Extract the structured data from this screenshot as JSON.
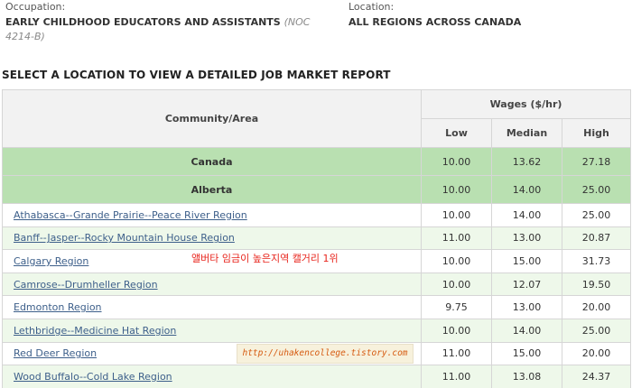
{
  "header": {
    "occupation_label": "Occupation:",
    "occupation_value": "EARLY CHILDHOOD EDUCATORS AND ASSISTANTS",
    "noc_code": "(NOC 4214-B)",
    "location_label": "Location:",
    "location_value": "ALL REGIONS ACROSS CANADA"
  },
  "section_title": "SELECT A LOCATION TO VIEW A DETAILED JOB MARKET REPORT",
  "table": {
    "col_community": "Community/Area",
    "col_wages": "Wages ($/hr)",
    "col_low": "Low",
    "col_median": "Median",
    "col_high": "High",
    "aggregates": [
      {
        "name": "Canada",
        "low": "10.00",
        "median": "13.62",
        "high": "27.18"
      },
      {
        "name": "Alberta",
        "low": "10.00",
        "median": "14.00",
        "high": "25.00"
      }
    ],
    "rows": [
      {
        "name": "Athabasca--Grande Prairie--Peace River Region",
        "low": "10.00",
        "median": "14.00",
        "high": "25.00"
      },
      {
        "name": "Banff--Jasper--Rocky Mountain House Region",
        "low": "11.00",
        "median": "13.00",
        "high": "20.87"
      },
      {
        "name": "Calgary Region",
        "low": "10.00",
        "median": "15.00",
        "high": "31.73"
      },
      {
        "name": "Camrose--Drumheller Region",
        "low": "10.00",
        "median": "12.07",
        "high": "19.50"
      },
      {
        "name": "Edmonton Region",
        "low": "9.75",
        "median": "13.00",
        "high": "20.00"
      },
      {
        "name": "Lethbridge--Medicine Hat Region",
        "low": "10.00",
        "median": "14.00",
        "high": "25.00"
      },
      {
        "name": "Red Deer Region",
        "low": "11.00",
        "median": "15.00",
        "high": "20.00"
      },
      {
        "name": "Wood Buffalo--Cold Lake Region",
        "low": "11.00",
        "median": "13.08",
        "high": "24.37"
      }
    ]
  },
  "annotations": {
    "korean_note": "앨버타 임금이 높은지역 캘거리 1위",
    "watermark_url": "http://uhakencollege.tistory.com"
  }
}
